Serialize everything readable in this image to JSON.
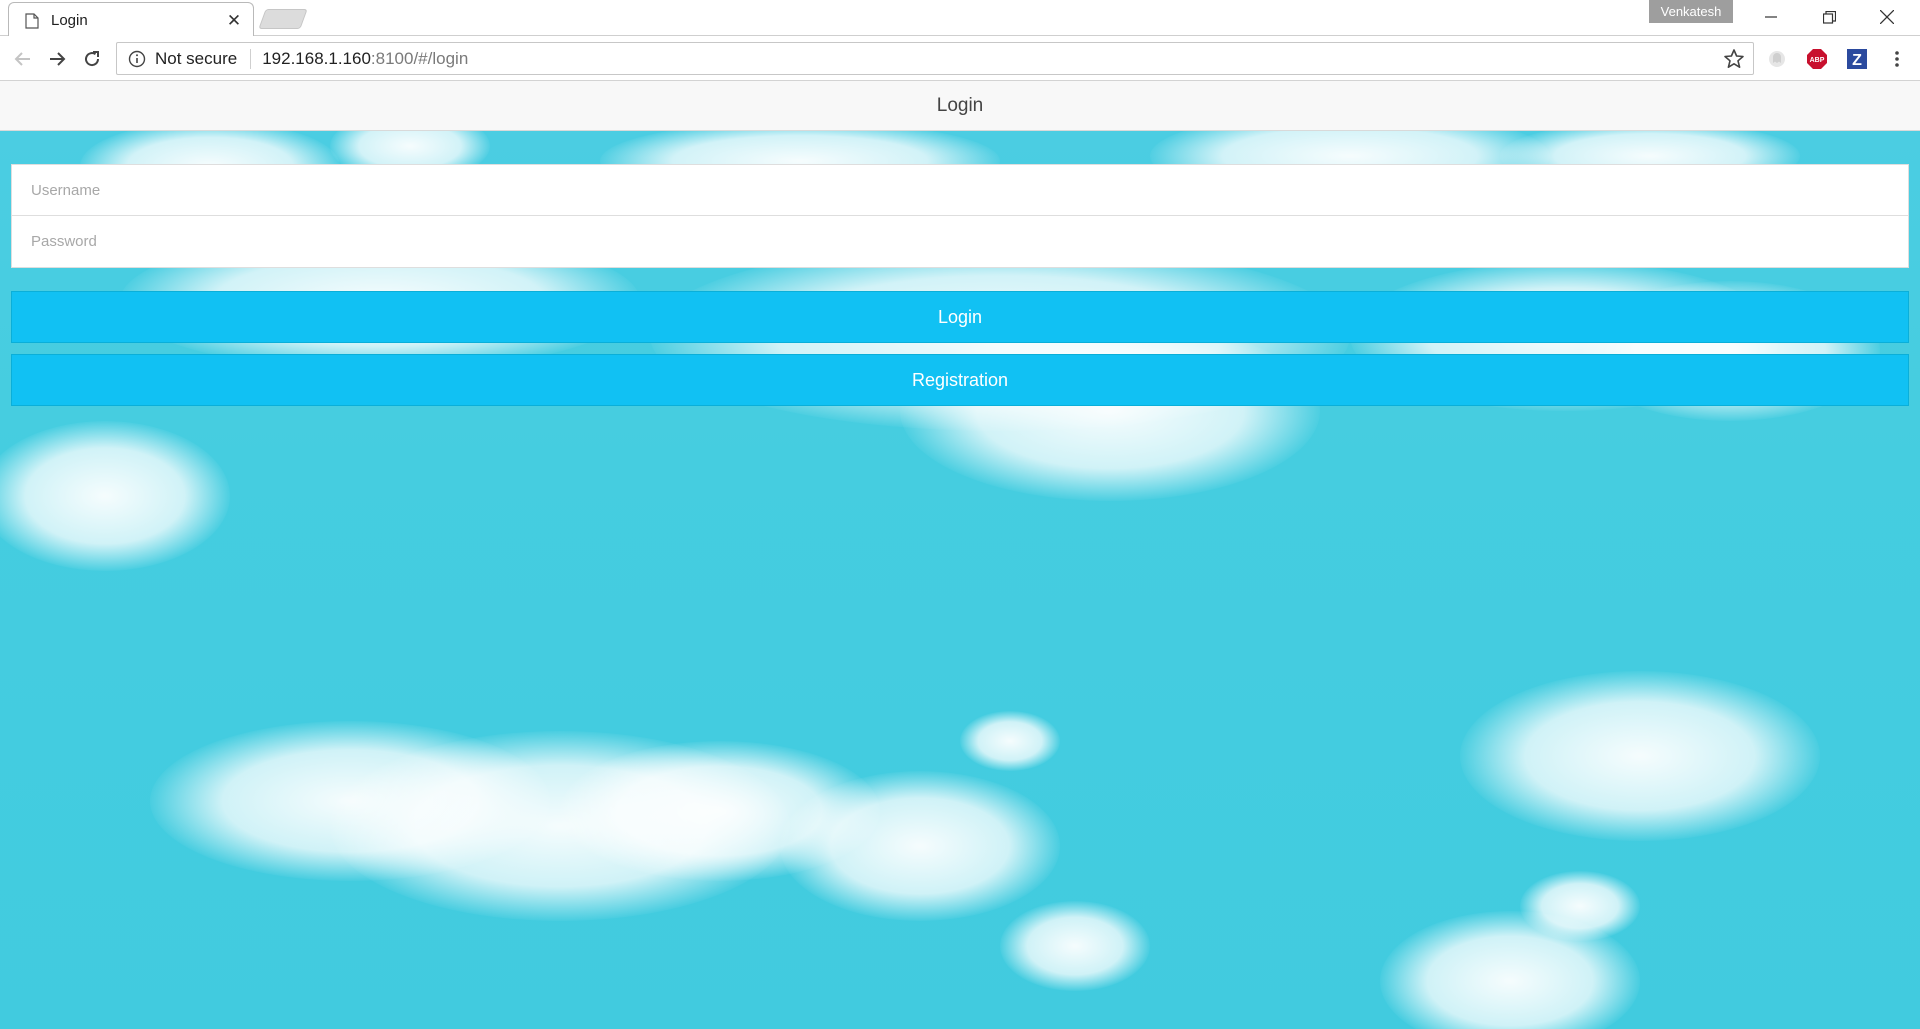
{
  "browser": {
    "tab": {
      "title": "Login"
    },
    "profile_name": "Venkatesh",
    "omnibox": {
      "security_label": "Not secure",
      "url_host": "192.168.1.160",
      "url_rest": ":8100/#/login"
    },
    "extensions": [
      "ghostery-icon",
      "adblock-plus-icon",
      "zotero-icon"
    ],
    "icons": {
      "back": "arrow-left-icon",
      "forward": "arrow-right-icon",
      "reload": "reload-icon",
      "info": "info-icon",
      "bookmark": "star-icon",
      "menu": "kebab-menu-icon"
    }
  },
  "app": {
    "header_title": "Login",
    "form": {
      "username_placeholder": "Username",
      "password_placeholder": "Password"
    },
    "buttons": {
      "login_label": "Login",
      "registration_label": "Registration"
    },
    "colors": {
      "button": "#11c1f3",
      "sky": "#45cde0",
      "header_bg": "#f8f8f8"
    }
  }
}
